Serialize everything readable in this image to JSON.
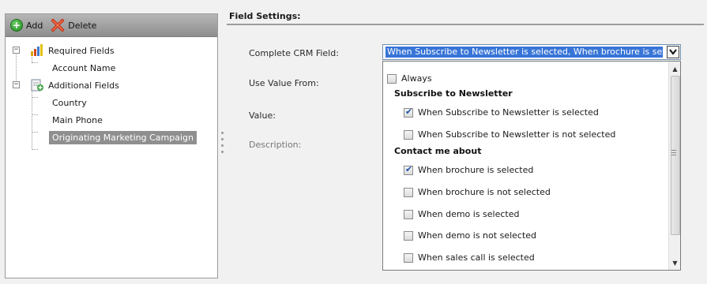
{
  "toolbar": {
    "add_label": "Add",
    "delete_label": "Delete"
  },
  "tree": {
    "required_fields": "Required Fields",
    "account_name": "Account Name",
    "additional_fields": "Additional Fields",
    "country": "Country",
    "main_phone": "Main Phone",
    "originating_campaign": "Originating Marketing Campaign"
  },
  "settings": {
    "header": "Field Settings:",
    "complete_crm_field_label": "Complete CRM Field:",
    "use_value_from_label": "Use Value From:",
    "value_label": "Value:",
    "description_label": "Description:",
    "combo_value": "When Subscribe to Newsletter is selected, When brochure is selected"
  },
  "dropdown": {
    "always": "Always",
    "group1": "Subscribe to Newsletter",
    "opt1": "When Subscribe to Newsletter is selected",
    "opt2": "When Subscribe to Newsletter is not selected",
    "group2": "Contact me about",
    "opt3": "When brochure is selected",
    "opt4": "When brochure is not selected",
    "opt5": "When demo is selected",
    "opt6": "When demo is not selected",
    "opt7": "When sales call is selected",
    "checked": {
      "always": false,
      "opt1": true,
      "opt2": false,
      "opt3": true,
      "opt4": false,
      "opt5": false,
      "opt6": false,
      "opt7": false
    }
  },
  "icons": {
    "add": "add-circle-icon",
    "delete": "delete-x-icon",
    "required_folder": "required-fields-icon",
    "additional_folder": "additional-fields-icon",
    "dropdown_arrow": "chevron-down-icon"
  },
  "colors": {
    "selection": "#3875d7",
    "tree_selected": "#8f8f8f",
    "checkbox_check": "#1d52a8"
  }
}
